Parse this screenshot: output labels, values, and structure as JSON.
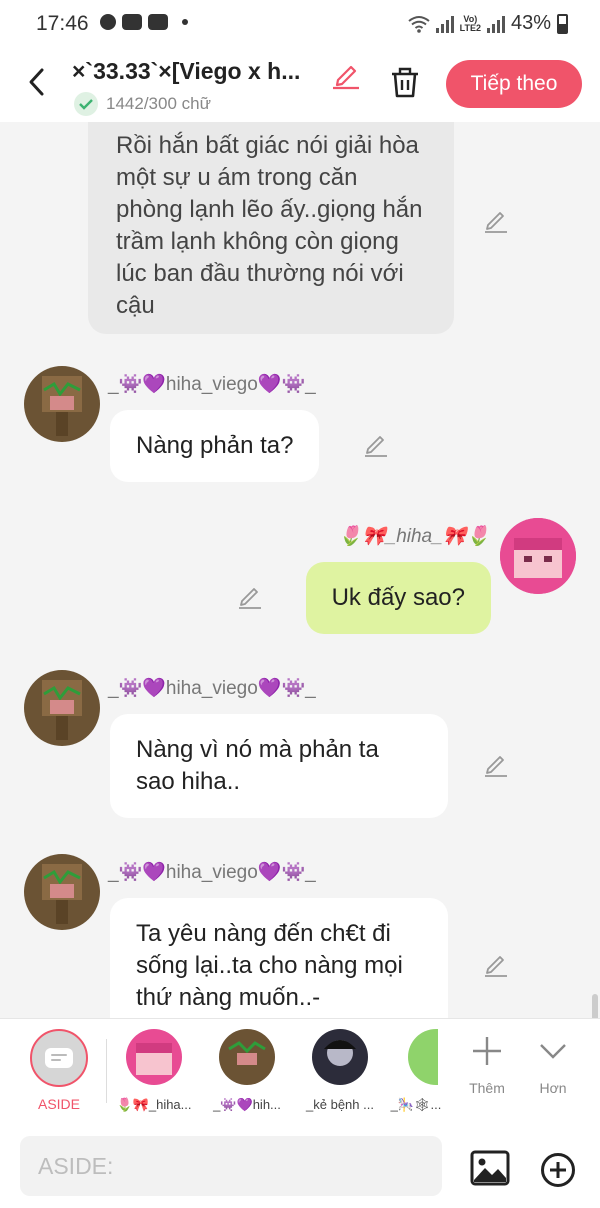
{
  "status_bar": {
    "time": "17:46",
    "battery": "43%"
  },
  "header": {
    "title": "×`33.33`×[Viego x h...",
    "word_count": "1442/300 chữ",
    "next_label": "Tiếp theo"
  },
  "messages": [
    {
      "type": "narration",
      "text": "Rồi hắn bất giác nói giải hòa một sự u ám trong căn phòng lạnh lẽo ấy..giọng hắn trầm lạnh không còn giọng lúc ban đầu thường nói với cậu"
    },
    {
      "type": "left",
      "username": "_👾💜hiha_viego💜👾_",
      "text": "Nàng phản ta?"
    },
    {
      "type": "right",
      "username": "🌷🎀_hiha_🎀🌷",
      "text": "Uk đấy sao?"
    },
    {
      "type": "left",
      "username": "_👾💜hiha_viego💜👾_",
      "text": "Nàng vì nó mà phản ta sao hiha.."
    },
    {
      "type": "left",
      "username": "_👾💜hiha_viego💜👾_",
      "text": "Ta yêu nàng đến ch€t đi sống lại..ta cho nàng mọi thứ nàng muốn..-"
    }
  ],
  "characters": {
    "aside_label": "ASIDE",
    "items": [
      {
        "name": "🌷🎀_hiha..."
      },
      {
        "name": "_👾💜hih..."
      },
      {
        "name": "_kẻ bệnh ..."
      },
      {
        "name": "_🎠🕸..."
      }
    ],
    "add_label": "Thêm",
    "more_label": "Hơn"
  },
  "input": {
    "placeholder": "ASIDE:"
  },
  "colors": {
    "accent": "#f0546a",
    "green_bubble": "#dff3a1",
    "narration_bubble": "#e9e9e9"
  }
}
